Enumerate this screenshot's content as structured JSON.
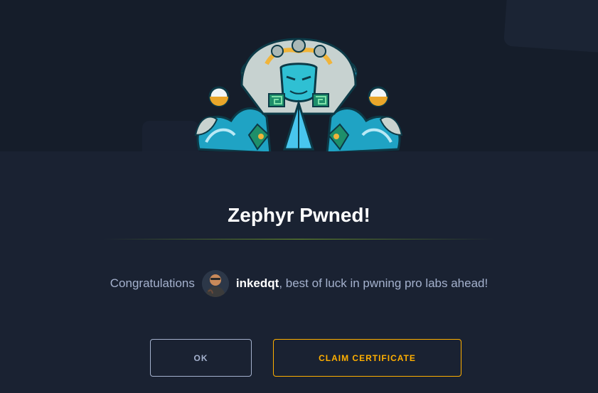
{
  "title": "Zephyr Pwned!",
  "message": {
    "prefix": "Congratulations",
    "username": "inkedqt",
    "suffix": ", best of luck in pwning pro labs ahead!"
  },
  "buttons": {
    "ok_label": "OK",
    "claim_label": "CLAIM CERTIFICATE"
  },
  "icons": {
    "emblem": "zephyr-emblem-icon",
    "avatar": "user-avatar"
  },
  "colors": {
    "background": "#1a2232",
    "banner": "#151d2a",
    "accent": "#ffaf00",
    "muted": "#a4b1cd",
    "divider": "#6f9a2a"
  }
}
